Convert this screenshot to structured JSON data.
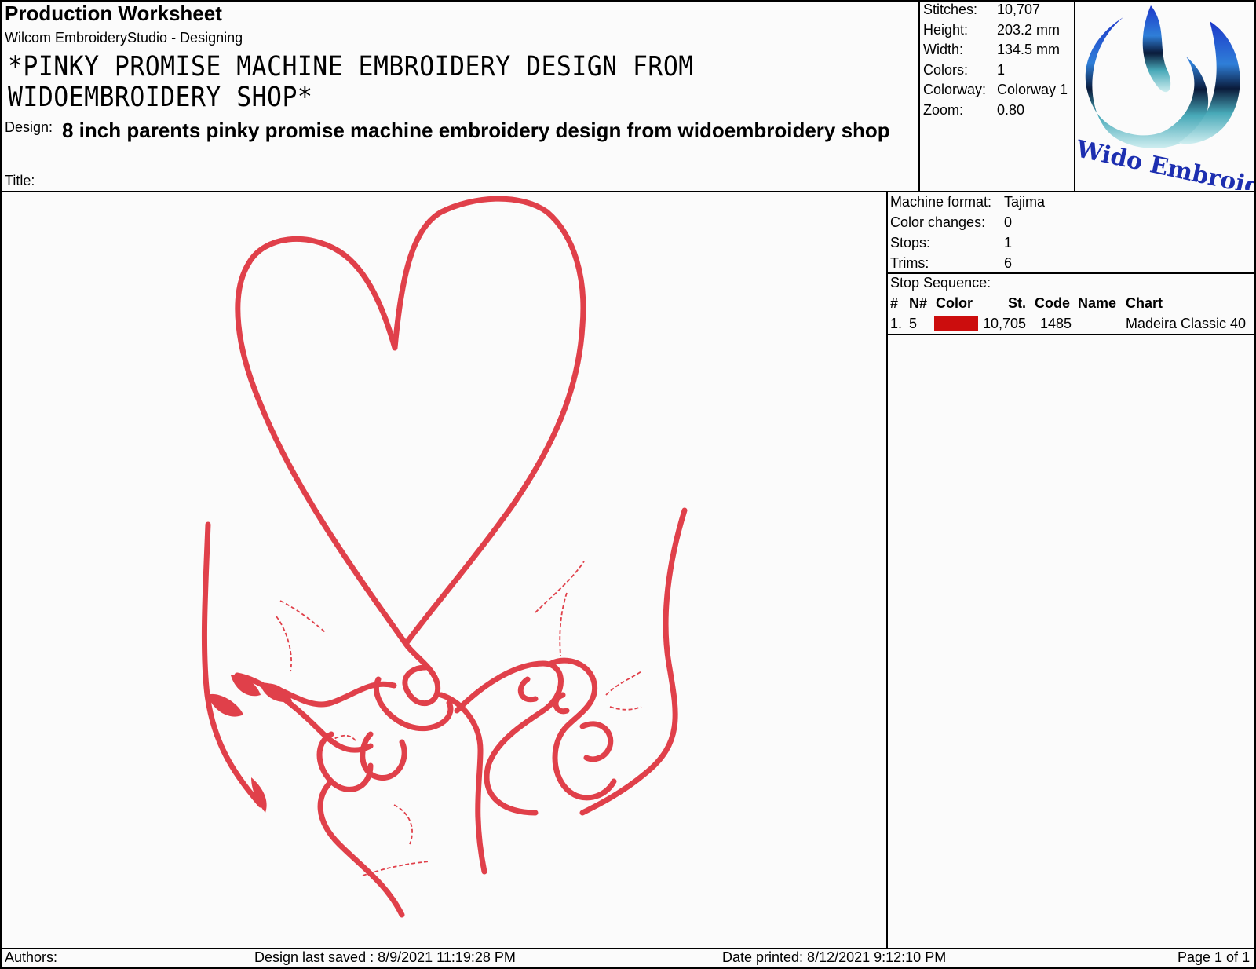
{
  "header": {
    "title": "Production Worksheet",
    "app": "Wilcom EmbroideryStudio - Designing",
    "design_name_caps": "*PINKY PROMISE MACHINE EMBROIDERY DESIGN FROM WIDOEMBROIDERY SHOP*",
    "design_label": "Design:",
    "design_value": "8 inch parents pinky promise machine embroidery design from widoembroidery shop",
    "title_label": "Title:"
  },
  "stats": {
    "stitches_label": "Stitches:",
    "stitches": "10,707",
    "height_label": "Height:",
    "height": "203.2 mm",
    "width_label": "Width:",
    "width": "134.5 mm",
    "colors_label": "Colors:",
    "colors": "1",
    "colorway_label": "Colorway:",
    "colorway": "Colorway 1",
    "zoom_label": "Zoom:",
    "zoom": "0.80"
  },
  "logo": {
    "text": "Wido Embroidery",
    "icon": "wido-swirl-logo-icon"
  },
  "machine": {
    "format_label": "Machine format:",
    "format": "Tajima",
    "color_changes_label": "Color changes:",
    "color_changes": "0",
    "stops_label": "Stops:",
    "stops": "1",
    "trims_label": "Trims:",
    "trims": "6"
  },
  "stop_sequence": {
    "label": "Stop Sequence:",
    "headers": {
      "num": "#",
      "n": "N#",
      "color": "Color",
      "st": "St.",
      "code": "Code",
      "name": "Name",
      "chart": "Chart"
    },
    "rows": [
      {
        "num": "1.",
        "n": "5",
        "color": "#cc0d0d",
        "st": "10,705",
        "code": "1485",
        "name": "",
        "chart": "Madeira Classic 40"
      }
    ]
  },
  "design_preview": {
    "thread_color": "#e0404a",
    "icon": "pinky-promise-heart-hands-icon"
  },
  "footer": {
    "authors": "Authors:",
    "last_saved": "Design last saved : 8/9/2021 11:19:28 PM",
    "date_printed": "Date printed: 8/12/2021 9:12:10 PM",
    "page": "Page 1 of 1"
  }
}
